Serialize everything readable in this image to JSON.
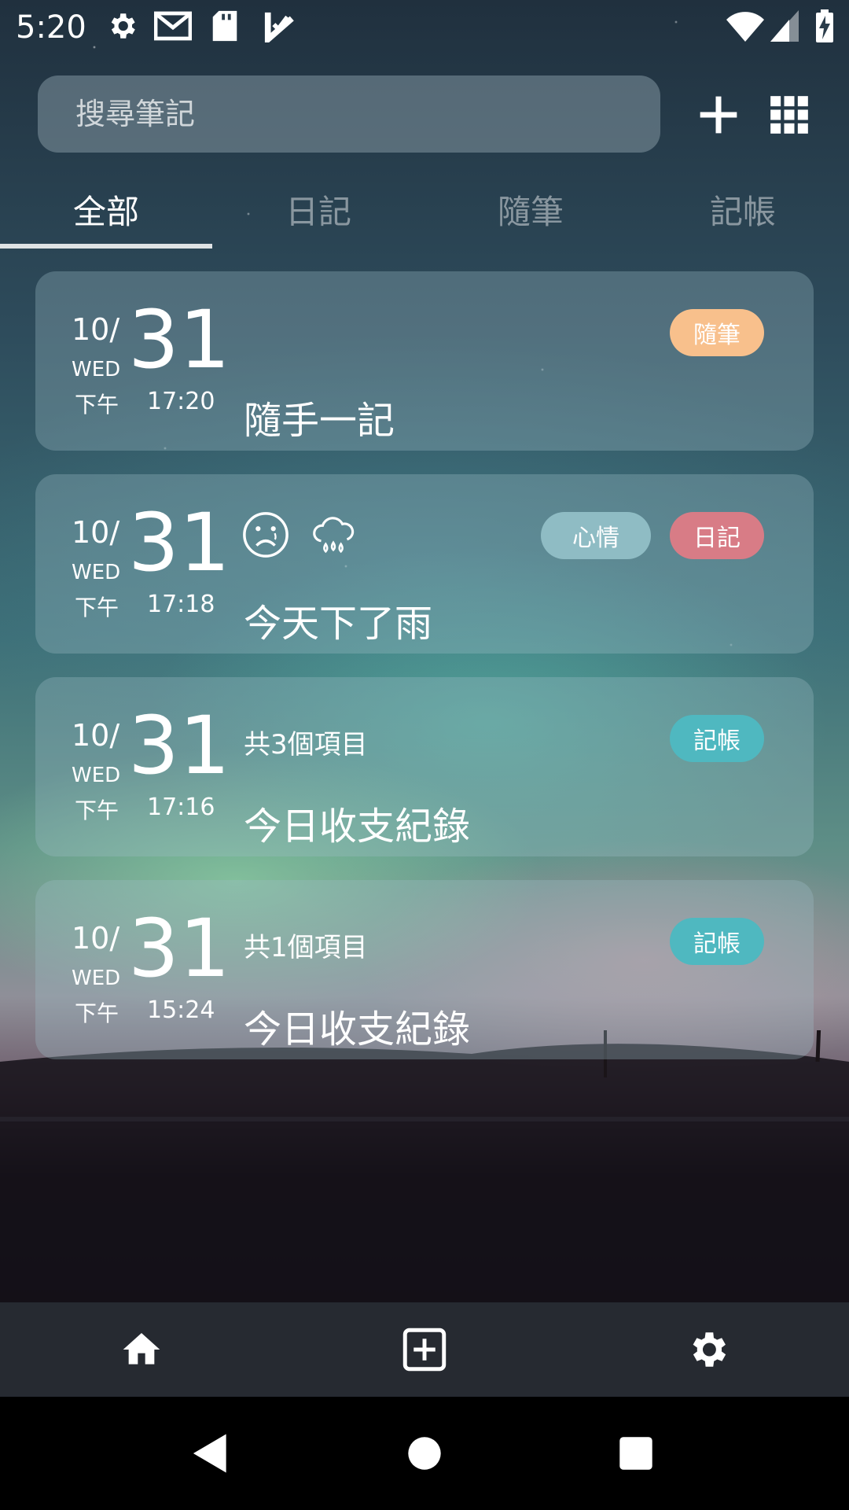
{
  "status_bar": {
    "time": "5:20",
    "icons": [
      "gear-icon",
      "gmail-icon",
      "sd-card-icon",
      "task-check-icon",
      "wifi-icon",
      "signal-icon",
      "battery-charging-icon"
    ]
  },
  "search": {
    "placeholder": "搜尋筆記"
  },
  "top_actions": {
    "add_icon": "plus-icon",
    "grid_icon": "grid-icon"
  },
  "tabs": [
    {
      "label": "全部",
      "active": true
    },
    {
      "label": "日記",
      "active": false
    },
    {
      "label": "隨筆",
      "active": false
    },
    {
      "label": "記帳",
      "active": false
    }
  ],
  "entries": [
    {
      "month": "10/",
      "day": "31",
      "weekday": "WED",
      "ampm": "下午",
      "time": "17:20",
      "title": "隨手一記",
      "badges": [
        {
          "label": "隨筆",
          "color": "#f8c08c"
        }
      ]
    },
    {
      "month": "10/",
      "day": "31",
      "weekday": "WED",
      "ampm": "下午",
      "time": "17:18",
      "title": "今天下了雨",
      "icons": [
        "sad-face-icon",
        "rain-cloud-icon"
      ],
      "badges": [
        {
          "label": "心情",
          "color": "#8fbcc4"
        },
        {
          "label": "日記",
          "color": "#d87c86"
        }
      ]
    },
    {
      "month": "10/",
      "day": "31",
      "weekday": "WED",
      "ampm": "下午",
      "time": "17:16",
      "subtitle": "共3個項目",
      "title": "今日收支紀錄",
      "badges": [
        {
          "label": "記帳",
          "color": "#4fb8c0"
        }
      ]
    },
    {
      "month": "10/",
      "day": "31",
      "weekday": "WED",
      "ampm": "下午",
      "time": "15:24",
      "subtitle": "共1個項目",
      "title": "今日收支紀錄",
      "badges": [
        {
          "label": "記帳",
          "color": "#4fb8c0"
        }
      ]
    }
  ],
  "bottom_nav": {
    "home": "home-icon",
    "add": "add-box-icon",
    "settings": "settings-icon"
  },
  "system_nav": {
    "back": "back-icon",
    "home": "home-circle-icon",
    "recents": "recents-icon"
  }
}
